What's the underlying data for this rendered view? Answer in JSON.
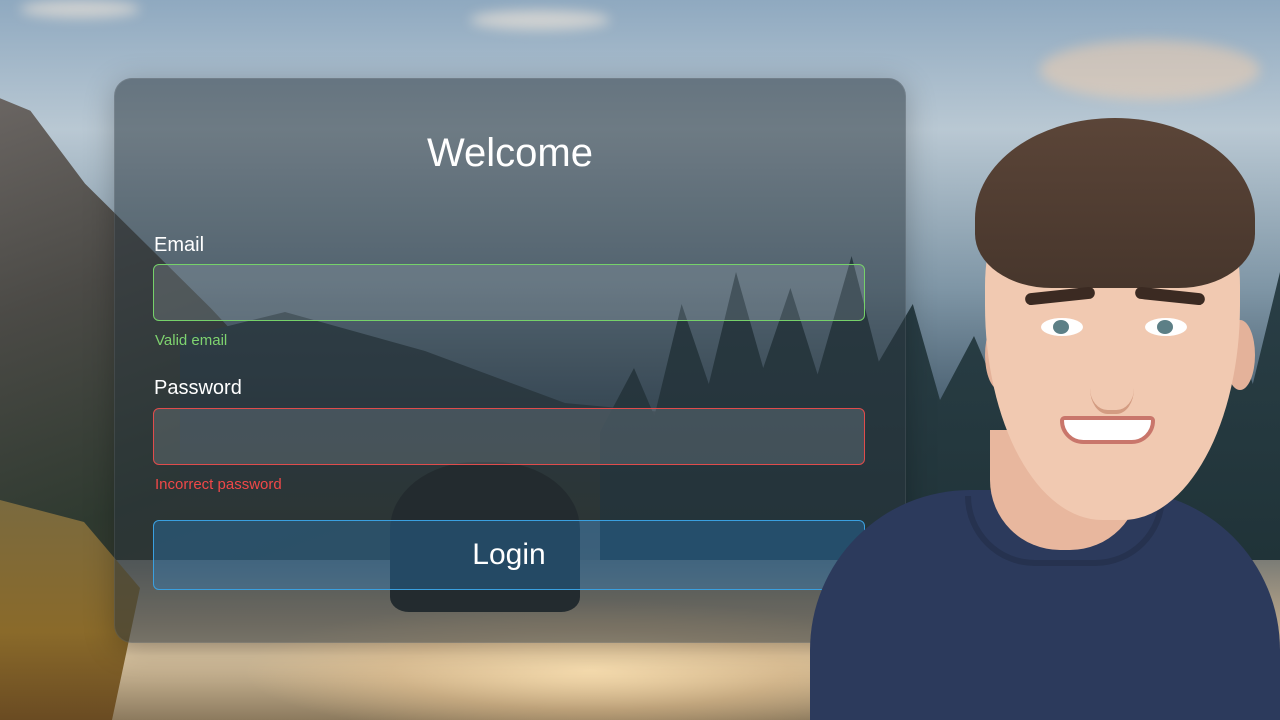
{
  "login_form": {
    "title": "Welcome",
    "email": {
      "label": "Email",
      "value": "",
      "placeholder": "",
      "status_text": "Valid email",
      "border_color": "#76d16a"
    },
    "password": {
      "label": "Password",
      "value": "",
      "placeholder": "",
      "status_text": "Incorrect password",
      "border_color": "#e04c4c"
    },
    "login_button_label": "Login",
    "accent_color": "#3aa0e0"
  }
}
